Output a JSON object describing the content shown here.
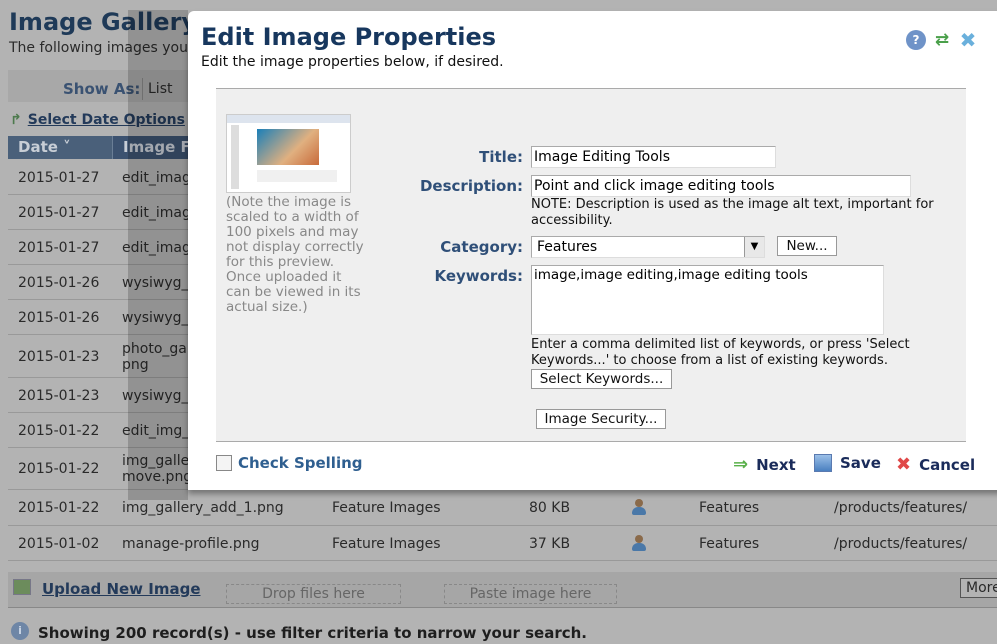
{
  "background": {
    "title": "Image Gallery",
    "subtitle": "The following images you",
    "show_as_label": "Show As:",
    "show_as_value": "List",
    "date_options": "Select Date Options",
    "columns": [
      "Date",
      "Image F"
    ],
    "rows": [
      {
        "date": "2015-01-27",
        "file": "edit_imag"
      },
      {
        "date": "2015-01-27",
        "file": "edit_imag"
      },
      {
        "date": "2015-01-27",
        "file": "edit_imag"
      },
      {
        "date": "2015-01-26",
        "file": "wysiwyg_"
      },
      {
        "date": "2015-01-26",
        "file": "wysiwyg_"
      },
      {
        "date": "2015-01-23",
        "file": "photo_ga\npng"
      },
      {
        "date": "2015-01-23",
        "file": "wysiwyg_"
      },
      {
        "date": "2015-01-22",
        "file": "edit_img_"
      },
      {
        "date": "2015-01-22",
        "file": "img_galle\nmove.png"
      },
      {
        "date": "2015-01-22",
        "file": "img_gallery_add_1.png",
        "folder": "Feature Images",
        "size": "80 KB",
        "category": "Features",
        "path": "/products/features/"
      },
      {
        "date": "2015-01-02",
        "file": "manage-profile.png",
        "folder": "Feature Images",
        "size": "37 KB",
        "category": "Features",
        "path": "/products/features/"
      }
    ],
    "upload_label": "Upload New Image",
    "drop_label": "Drop files here",
    "paste_label": "Paste image here",
    "more_label": "More",
    "status": "Showing 200 record(s) - use filter criteria to narrow your search."
  },
  "modal": {
    "title": "Edit Image Properties",
    "subtitle": "Edit the image properties below, if desired.",
    "preview_note": "(Note the image is scaled to a width of 100 pixels and may not display correctly for this preview. Once uploaded it can be viewed in its actual size.)",
    "title_label": "Title:",
    "title_value": "Image Editing Tools",
    "description_label": "Description:",
    "description_value": "Point and click image editing tools",
    "description_note": "NOTE: Description is used as the image alt text, important for accessibility.",
    "category_label": "Category:",
    "category_value": "Features",
    "new_button": "New...",
    "keywords_label": "Keywords:",
    "keywords_value": "image,image editing,image editing tools",
    "keywords_hint": "Enter a comma delimited list of keywords, or press 'Select Keywords...' to choose from a list of existing keywords.",
    "select_keywords_button": "Select Keywords...",
    "image_security_button": "Image Security...",
    "check_spelling": "Check Spelling",
    "next": "Next",
    "save": "Save",
    "cancel": "Cancel",
    "icons": [
      "help-icon",
      "refresh-icon",
      "close-icon"
    ]
  }
}
